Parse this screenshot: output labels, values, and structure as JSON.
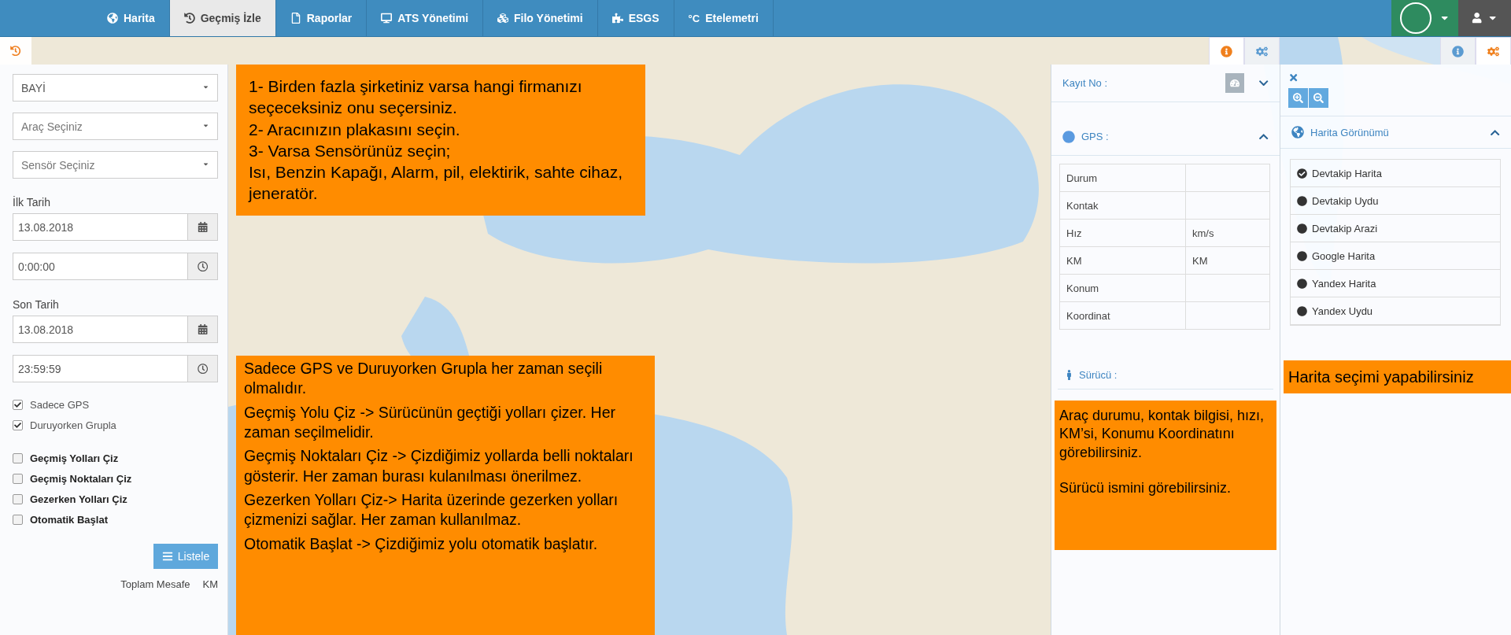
{
  "nav": {
    "items": [
      {
        "label": "Harita",
        "selected": false
      },
      {
        "label": "Geçmiş İzle",
        "selected": true
      },
      {
        "label": "Raporlar",
        "selected": false
      },
      {
        "label": "ATS Yönetimi",
        "selected": false
      },
      {
        "label": "Filo Yönetimi",
        "selected": false
      },
      {
        "label": "ESGS",
        "selected": false
      },
      {
        "label": "Etelemetri",
        "selected": false,
        "icon_text": "°C"
      }
    ]
  },
  "history": {
    "selects": [
      {
        "value": "BAYİ"
      },
      {
        "placeholder": "Araç Seçiniz"
      },
      {
        "placeholder": "Sensör Seçiniz"
      }
    ],
    "ranges": [
      {
        "label": "İlk Tarih",
        "date": "13.08.2018",
        "time": "0:00:00"
      },
      {
        "label": "Son Tarih",
        "date": "13.08.2018",
        "time": "23:59:59"
      }
    ],
    "options": [
      {
        "label": "Sadece GPS",
        "checked": true
      },
      {
        "label": "Duruyorken Grupla",
        "checked": true
      },
      {
        "label": "Geçmiş Yolları Çiz",
        "checked": false
      },
      {
        "label": "Geçmiş Noktaları Çiz",
        "checked": false
      },
      {
        "label": "Gezerken Yolları Çiz",
        "checked": false
      },
      {
        "label": "Otomatik Başlat",
        "checked": false
      }
    ],
    "list_button": "Listele",
    "total": {
      "label": "Toplam Mesafe",
      "unit": "KM"
    }
  },
  "map_notes": [
    {
      "paragraphs": [
        "1- Birden fazla şirketiniz varsa hangi firmanızı seçeceksiniz onu seçersiniz.",
        "2- Aracınızın plakasını seçin.",
        "3- Varsa Sensörünüz seçin;",
        "Isı, Benzin Kapağı, Alarm, pil, elektirik, sahte cihaz, jeneratör."
      ]
    },
    {
      "paragraphs": [
        "Sadece GPS ve Duruyorken Grupla her zaman seçili olmalıdır.",
        "Geçmiş Yolu Çiz -> Sürücünün geçtiği yolları çizer. Her zaman seçilmelidir.",
        "Geçmiş Noktaları Çiz -> Çizdiğimiz yollarda belli noktaları gösterir. Her zaman burası kulanılması önerilmez.",
        "Gezerken Yolları Çiz-> Harita üzerinde gezerken yolları çizmenizi sağlar. Her zaman kullanılmaz.",
        "Otomatik Başlat -> Çizdiğimiz yolu otomatik başlatır."
      ]
    }
  ],
  "info_panel": {
    "tabs": [
      {
        "kind": "info",
        "selected": true
      },
      {
        "kind": "settings",
        "selected": false
      }
    ],
    "record": {
      "label": "Kayıt No :",
      "expanded": false
    },
    "gps": {
      "label": "GPS :",
      "expanded": true,
      "rows": [
        {
          "label": "Durum"
        },
        {
          "label": "Kontak"
        },
        {
          "label": "Hız",
          "value": "km/s"
        },
        {
          "label": "KM",
          "value": "KM"
        },
        {
          "label": "Konum"
        },
        {
          "label": "Koordinat"
        }
      ]
    },
    "driver": {
      "label": "Sürücü :"
    },
    "note": {
      "paragraphs": [
        "Araç durumu, kontak bilgisi, hızı, KM’si, Konumu Koordinatını görebilirsiniz.",
        "Sürücü ismini görebilirsiniz."
      ]
    }
  },
  "map_panel": {
    "tabs": [
      {
        "kind": "info",
        "selected": false
      },
      {
        "kind": "settings",
        "selected": true
      }
    ],
    "section": {
      "label": "Harita Görünümü",
      "expanded": true
    },
    "layers": [
      {
        "label": "Devtakip Harita",
        "selected": true
      },
      {
        "label": "Devtakip Uydu",
        "selected": false
      },
      {
        "label": "Devtakip Arazi",
        "selected": false
      },
      {
        "label": "Google Harita",
        "selected": false
      },
      {
        "label": "Yandex Harita",
        "selected": false
      },
      {
        "label": "Yandex Uydu",
        "selected": false
      }
    ],
    "note": {
      "paragraphs": [
        "Harita seçimi yapabilirsiniz"
      ]
    }
  }
}
